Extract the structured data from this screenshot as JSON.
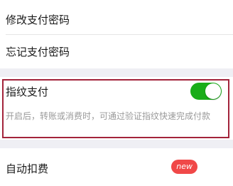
{
  "settings": {
    "change_password": {
      "label": "修改支付密码"
    },
    "forgot_password": {
      "label": "忘记支付密码"
    },
    "fingerprint_pay": {
      "label": "指纹支付",
      "enabled": true,
      "description": "开启后，转账或消费时，可通过验证指纹快速完成付款"
    },
    "auto_deduct": {
      "label": "自动扣费",
      "badge": "new"
    }
  },
  "colors": {
    "toggle_on": "#1aad19",
    "highlight_border": "#a3243b",
    "badge_bg": "#f04848",
    "page_bg": "#efeff4"
  }
}
